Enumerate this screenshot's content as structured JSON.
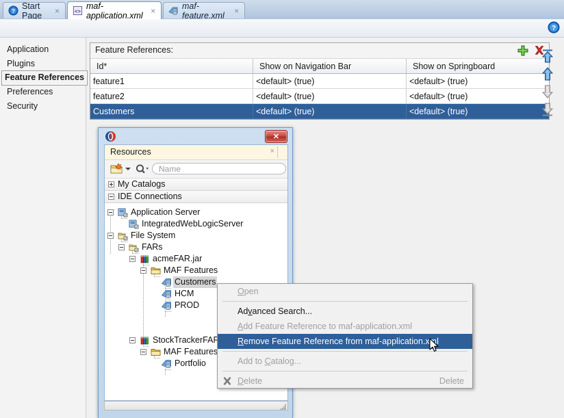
{
  "tabs": [
    {
      "label": "Start Page",
      "icon": "help-circle-icon",
      "active": false,
      "close": "×"
    },
    {
      "label": "maf-application.xml",
      "icon": "xml-code-icon",
      "active": true,
      "close": "×"
    },
    {
      "label": "maf-feature.xml",
      "icon": "mobile-feature-icon",
      "active": false,
      "close": "×"
    }
  ],
  "toolbar": {
    "help_icon": "help-circle-icon"
  },
  "sidebar": {
    "items": [
      {
        "label": "Application",
        "selected": false
      },
      {
        "label": "Plugins",
        "selected": false
      },
      {
        "label": "Feature References",
        "selected": true
      },
      {
        "label": "Preferences",
        "selected": false
      },
      {
        "label": "Security",
        "selected": false
      }
    ]
  },
  "main": {
    "section_title": "Feature References:",
    "add_icon": "green-plus-icon",
    "delete_icon": "red-x-icon",
    "columns": [
      "Id*",
      "Show on Navigation Bar",
      "Show on Springboard"
    ],
    "rows": [
      {
        "id": "feature1",
        "nav": "<default> (true)",
        "spring": "<default> (true)",
        "selected": false
      },
      {
        "id": "feature2",
        "nav": "<default> (true)",
        "spring": "<default> (true)",
        "selected": false
      },
      {
        "id": "Customers",
        "nav": "<default> (true)",
        "spring": "<default> (true)",
        "selected": true
      }
    ],
    "order_tools": [
      {
        "name": "move-to-top-button",
        "enabled": true
      },
      {
        "name": "move-up-button",
        "enabled": true
      },
      {
        "name": "move-down-button",
        "enabled": false
      },
      {
        "name": "move-to-bottom-button",
        "enabled": false
      }
    ]
  },
  "dialog": {
    "logo_icon": "oracle-logo-icon",
    "close_label": "✕",
    "panel_title": "Resources",
    "panel_close": "×",
    "new_icon": "new-folder-icon",
    "search_icon": "search-icon",
    "search_placeholder": "Name",
    "search_value": "",
    "groups": [
      {
        "label": "My Catalogs",
        "expanded": false
      },
      {
        "label": "IDE Connections",
        "expanded": true
      }
    ],
    "tree": [
      {
        "label": "Application Server",
        "icon": "server-icon",
        "depth": 0,
        "toggle": "minus",
        "selected": false
      },
      {
        "label": "IntegratedWebLogicServer",
        "icon": "server-icon",
        "depth": 1,
        "toggle": "none",
        "selected": false
      },
      {
        "label": "File System",
        "icon": "filesystem-icon",
        "depth": 0,
        "toggle": "minus",
        "selected": false
      },
      {
        "label": "FARs",
        "icon": "filesystem-icon",
        "depth": 1,
        "toggle": "minus",
        "selected": false
      },
      {
        "label": "acmeFAR.jar",
        "icon": "jar-archive-icon",
        "depth": 2,
        "toggle": "minus",
        "selected": false
      },
      {
        "label": "MAF Features",
        "icon": "folder-icon",
        "depth": 3,
        "toggle": "minus",
        "selected": false
      },
      {
        "label": "Customers",
        "icon": "mobile-feature-icon",
        "depth": 4,
        "toggle": "none",
        "selected": true
      },
      {
        "label": "HCM",
        "icon": "mobile-feature-icon",
        "depth": 4,
        "toggle": "none",
        "selected": false
      },
      {
        "label": "PROD",
        "icon": "mobile-feature-icon",
        "depth": 4,
        "toggle": "none",
        "selected": false
      },
      {
        "label": "StockTrackerFAR.j",
        "icon": "jar-archive-icon",
        "depth": 2,
        "toggle": "minus",
        "selected": false
      },
      {
        "label": "MAF Features",
        "icon": "folder-icon",
        "depth": 3,
        "toggle": "minus",
        "selected": false
      },
      {
        "label": "Portfolio",
        "icon": "mobile-feature-icon",
        "depth": 4,
        "toggle": "none",
        "selected": false
      }
    ]
  },
  "context_menu": {
    "items": [
      {
        "label": "Open",
        "accel": "O",
        "state": "disabled",
        "shortcut": "",
        "icon": ""
      },
      {
        "separator": true
      },
      {
        "label": "Advanced Search...",
        "accel": "v",
        "state": "normal",
        "shortcut": "",
        "icon": ""
      },
      {
        "label": "Add Feature Reference to maf-application.xml",
        "accel": "A",
        "state": "disabled",
        "shortcut": "",
        "icon": ""
      },
      {
        "label": "Remove Feature Reference from maf-application.xml",
        "accel": "R",
        "state": "highlighted",
        "shortcut": "",
        "icon": ""
      },
      {
        "separator": true
      },
      {
        "label": "Add to Catalog...",
        "accel": "C",
        "state": "disabled",
        "shortcut": "",
        "icon": ""
      },
      {
        "separator": true
      },
      {
        "label": "Delete",
        "accel": "D",
        "state": "disabled",
        "shortcut": "Delete",
        "icon": "delete-x-icon"
      }
    ]
  },
  "colors": {
    "selection_blue": "#2e5f99",
    "tab_strip": "#bdcfe4",
    "dialog_frame": "#c2d6ea",
    "accent_green": "#4caf2f",
    "accent_red": "#d32f2f"
  }
}
